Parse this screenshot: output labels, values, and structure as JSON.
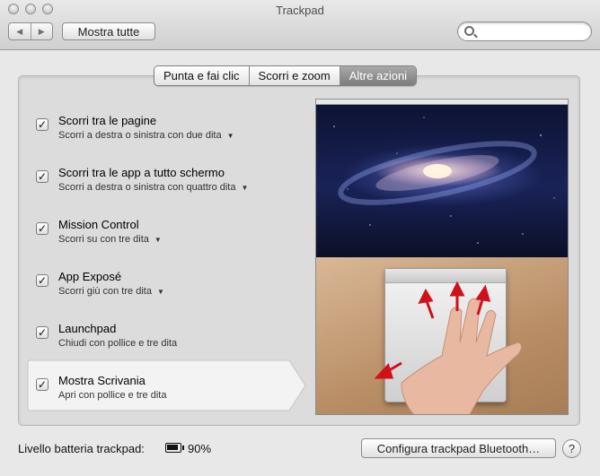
{
  "window": {
    "title": "Trackpad",
    "nav_back_icon": "◀",
    "nav_forward_icon": "▶",
    "show_all_label": "Mostra tutte",
    "search_placeholder": ""
  },
  "tabs": [
    {
      "label": "Punta e fai clic",
      "active": false
    },
    {
      "label": "Scorri e zoom",
      "active": false
    },
    {
      "label": "Altre azioni",
      "active": true
    }
  ],
  "gestures": [
    {
      "title": "Scorri tra le pagine",
      "subtitle": "Scorri a destra o sinistra con due dita",
      "checked": true,
      "has_menu": true
    },
    {
      "title": "Scorri tra le app a tutto schermo",
      "subtitle": "Scorri a destra o sinistra con quattro dita",
      "checked": true,
      "has_menu": true
    },
    {
      "title": "Mission Control",
      "subtitle": "Scorri su con tre dita",
      "checked": true,
      "has_menu": true
    },
    {
      "title": "App Exposé",
      "subtitle": "Scorri giù con tre dita",
      "checked": true,
      "has_menu": true
    },
    {
      "title": "Launchpad",
      "subtitle": "Chiudi con pollice e tre dita",
      "checked": true,
      "has_menu": false
    },
    {
      "title": "Mostra Scrivania",
      "subtitle": "Apri con pollice e tre dita",
      "checked": true,
      "has_menu": false,
      "selected": true
    }
  ],
  "checkmark": "✓",
  "menu_triangle": "▼",
  "footer": {
    "battery_label": "Livello batteria trackpad:",
    "battery_percent": "90%",
    "battery_level": 0.9,
    "configure_button": "Configura trackpad Bluetooth…",
    "help_label": "?"
  },
  "colors": {
    "active_tab": "#8a8a8a",
    "arrow": "#d0101a"
  }
}
